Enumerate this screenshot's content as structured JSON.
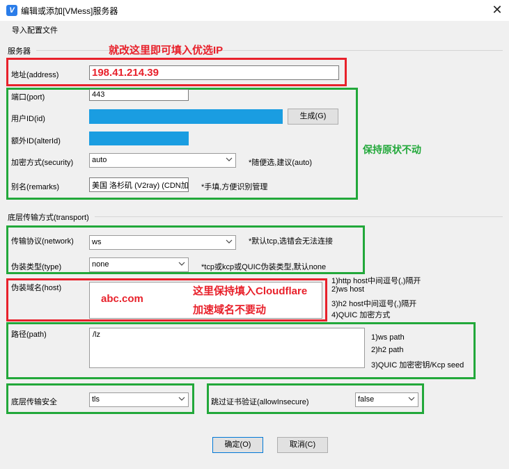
{
  "window": {
    "title": "编辑或添加[VMess]服务器",
    "close_glyph": "✕",
    "app_icon_glyph": "V"
  },
  "menu": {
    "import_config": "导入配置文件"
  },
  "server_section": {
    "title": "服务器",
    "address_label": "地址(address)",
    "address_value": "198.41.214.39",
    "port_label": "端口(port)",
    "port_value": "443",
    "userid_label": "用户ID(id)",
    "generate_button": "生成(G)",
    "alterid_label": "额外ID(alterId)",
    "security_label": "加密方式(security)",
    "security_value": "auto",
    "security_hint": "*随便选,建议(auto)",
    "remarks_label": "别名(remarks)",
    "remarks_value": "美国 洛杉矶 (V2ray) (CDN加",
    "remarks_hint": "*手填,方便识别管理"
  },
  "transport_section": {
    "title": "底层传输方式(transport)",
    "network_label": "传输协议(network)",
    "network_value": "ws",
    "network_hint": "*默认tcp,选错会无法连接",
    "type_label": "伪装类型(type)",
    "type_value": "none",
    "type_hint": "*tcp或kcp或QUIC伪装类型,默认none",
    "host_label": "伪装域名(host)",
    "host_hints": [
      "1)http host中间逗号(,)隔开",
      "2)ws host",
      "3)h2 host中间逗号(,)隔开",
      "4)QUIC 加密方式"
    ],
    "path_label": "路径(path)",
    "path_value": "/lz",
    "path_hints": [
      "1)ws path",
      "2)h2 path",
      "3)QUIC 加密密钥/Kcp seed"
    ],
    "stream_security_label": "底层传输安全",
    "stream_security_value": "tls",
    "allow_insecure_label": "跳过证书验证(allowInsecure)",
    "allow_insecure_value": "false"
  },
  "buttons": {
    "ok": "确定(O)",
    "cancel": "取消(C)"
  },
  "annotations": {
    "address_note": "就改这里即可填入优选IP",
    "keep_note": "保持原状不动",
    "host_value": "abc.com",
    "host_note_line1": "这里保持填入Cloudflare",
    "host_note_line2": "加速域名不要动"
  },
  "colors": {
    "annotation_red": "#e8212b",
    "annotation_green": "#22a83a",
    "selection_blue": "#1a9de1"
  }
}
